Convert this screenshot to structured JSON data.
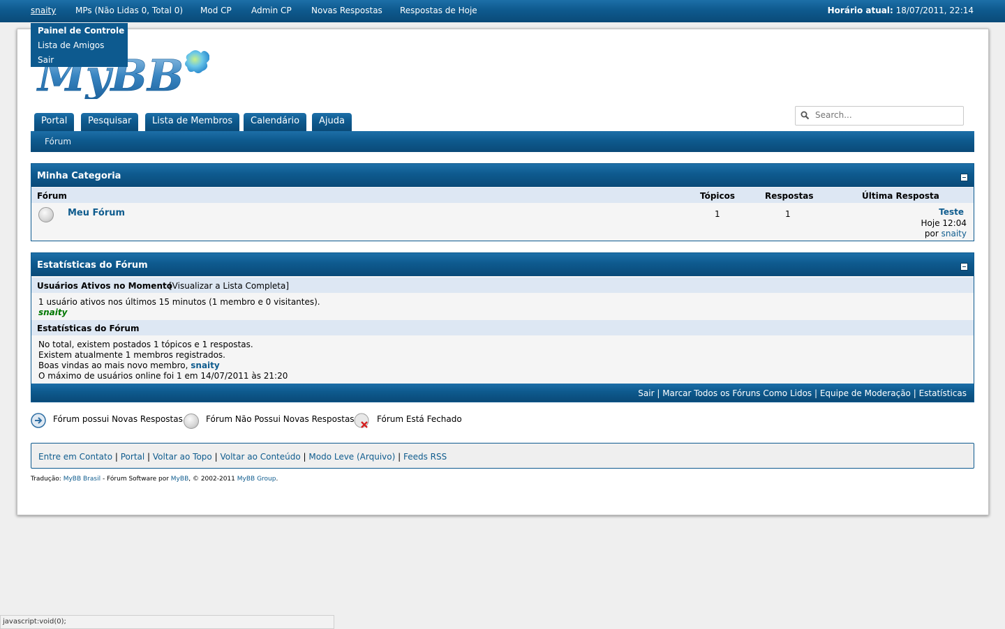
{
  "topbar": {
    "user": "snaity",
    "pms": "MPs (Não Lidas 0, Total 0)",
    "mod_cp": "Mod CP",
    "admin_cp": "Admin CP",
    "new_replies": "Novas Respostas",
    "today_replies": "Respostas de Hoje",
    "clock_label": "Horário atual:",
    "clock_value": "18/07/2011, 22:14"
  },
  "user_menu": {
    "control_panel": "Painel de Controle",
    "friends": "Lista de Amigos",
    "logout": "Sair"
  },
  "logo_text": "MyBB",
  "tabs": [
    "Portal",
    "Pesquisar",
    "Lista de Membros",
    "Calendário",
    "Ajuda"
  ],
  "search": {
    "placeholder": "Search..."
  },
  "breadcrumb": "Fórum",
  "category": {
    "title": "Minha Categoria",
    "columns": {
      "forum": "Fórum",
      "topics": "Tópicos",
      "replies": "Respostas",
      "last": "Última Resposta"
    },
    "forums": [
      {
        "name": "Meu Fórum",
        "topics": "1",
        "replies": "1",
        "last_title": "Teste",
        "last_time": "Hoje 12:04",
        "last_by_prefix": "por",
        "last_by": "snaity"
      }
    ]
  },
  "stats": {
    "title": "Estatísticas do Fórum",
    "active_heading": "Usuários Ativos no Momento",
    "active_link": "[Visualizar a Lista Completa]",
    "active_text": "1 usuário ativos nos últimos 15 minutos (1 membro e 0 visitantes).",
    "active_user": "snaity",
    "stats_heading": "Estatísticas do Fórum",
    "line1": "No total, existem postados 1 tópicos e 1 respostas.",
    "line2": "Existem atualmente 1 membros registrados.",
    "line3_prefix": "Boas vindas ao mais novo membro,",
    "line3_user": "snaity",
    "line4": "O máximo de usuários online foi 1 em 14/07/2011 às 21:20",
    "footer_links": [
      "Sair",
      "Marcar Todos os Fóruns Como Lidos",
      "Equipe de Moderação",
      "Estatísticas"
    ]
  },
  "legend": {
    "new": "Fórum possui Novas Respostas",
    "no_new": "Fórum Não Possui Novas Respostas",
    "closed": "Fórum Está Fechado"
  },
  "footer_links": [
    "Entre em Contato",
    "Portal",
    "Voltar ao Topo",
    "Voltar ao Conteúdo",
    "Modo Leve (Arquivo)",
    "Feeds RSS"
  ],
  "copyright": {
    "prefix": "Tradução:",
    "translator": "MyBB Brasil",
    "middle": "- Fórum Software por",
    "software": "MyBB",
    "years": ", © 2002-2011",
    "group": "MyBB Group",
    "end": "."
  },
  "statusbar": "javascript:void(0);",
  "colors": {
    "accent": "#0d5a8f",
    "link": "#0f5c8e",
    "active_user": "#007700"
  }
}
